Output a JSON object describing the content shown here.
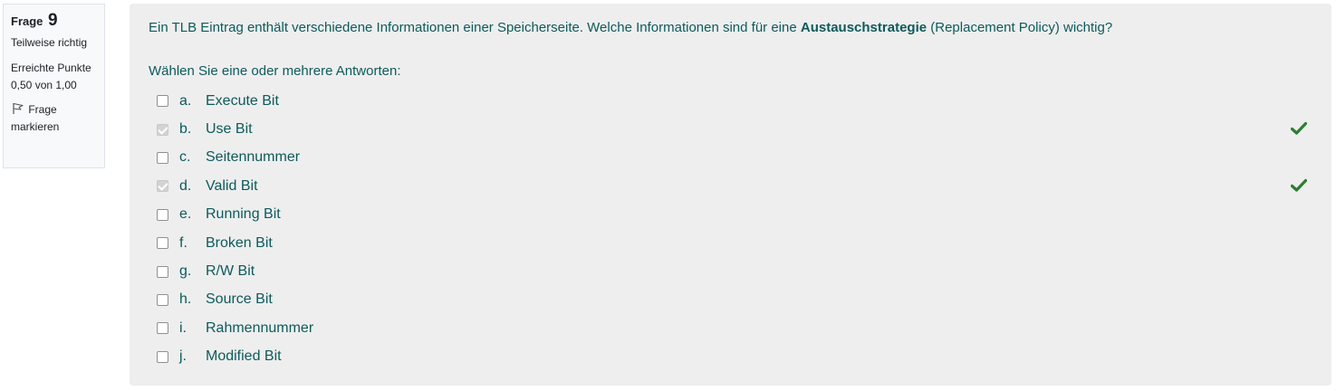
{
  "info": {
    "label": "Frage",
    "number": "9",
    "state": "Teilweise richtig",
    "grade": "Erreichte Punkte 0,50 von 1,00",
    "flag": "Frage markieren"
  },
  "question": {
    "text_before": "Ein TLB Eintrag enthält verschiedene Informationen einer Speicherseite. Welche Informationen sind für eine ",
    "text_bold": "Austauschstrategie",
    "text_after": " (Replacement Policy) wichtig?",
    "prompt": "Wählen Sie eine oder mehrere Antworten:"
  },
  "answers": [
    {
      "letter": "a.",
      "label": "Execute Bit",
      "checked": false,
      "correct": false
    },
    {
      "letter": "b.",
      "label": "Use Bit",
      "checked": true,
      "correct": true
    },
    {
      "letter": "c.",
      "label": "Seitennummer",
      "checked": false,
      "correct": false
    },
    {
      "letter": "d.",
      "label": "Valid Bit",
      "checked": true,
      "correct": true
    },
    {
      "letter": "e.",
      "label": "Running Bit",
      "checked": false,
      "correct": false
    },
    {
      "letter": "f.",
      "label": "Broken Bit",
      "checked": false,
      "correct": false
    },
    {
      "letter": "g.",
      "label": "R/W Bit",
      "checked": false,
      "correct": false
    },
    {
      "letter": "h.",
      "label": "Source Bit",
      "checked": false,
      "correct": false
    },
    {
      "letter": "i.",
      "label": "Rahmennummer",
      "checked": false,
      "correct": false
    },
    {
      "letter": "j.",
      "label": "Modified Bit",
      "checked": false,
      "correct": false
    }
  ],
  "colors": {
    "text": "#0e5a5c",
    "panel": "#eeeeee",
    "check": "#2e7d32"
  }
}
